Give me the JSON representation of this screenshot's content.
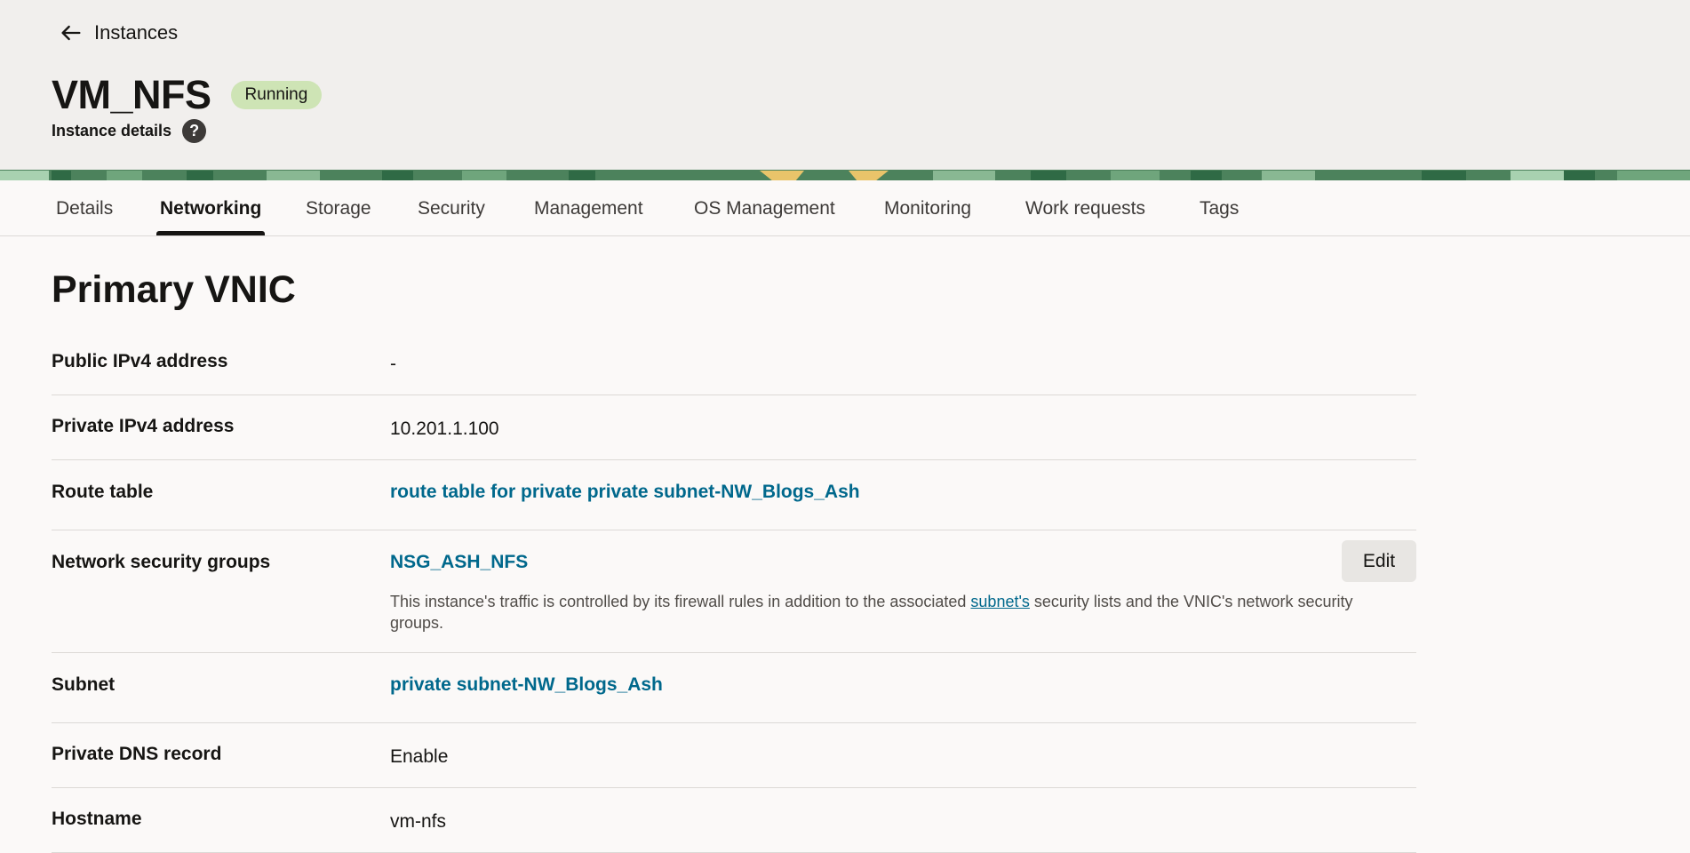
{
  "breadcrumb": {
    "back_label": "Instances"
  },
  "header": {
    "title": "VM_NFS",
    "status": "Running",
    "subtitle": "Instance details",
    "help_icon": "?"
  },
  "tabs": [
    {
      "label": "Details",
      "active": false
    },
    {
      "label": "Networking",
      "active": true
    },
    {
      "label": "Storage",
      "active": false
    },
    {
      "label": "Security",
      "active": false
    },
    {
      "label": "Management",
      "active": false
    },
    {
      "label": "OS Management",
      "active": false
    },
    {
      "label": "Monitoring",
      "active": false
    },
    {
      "label": "Work requests",
      "active": false
    },
    {
      "label": "Tags",
      "active": false
    }
  ],
  "vnic": {
    "title": "Primary VNIC",
    "public_ipv4": {
      "label": "Public IPv4 address",
      "value": "-"
    },
    "private_ipv4": {
      "label": "Private IPv4 address",
      "value": "10.201.1.100"
    },
    "route_table": {
      "label": "Route table",
      "value": "route table for private private subnet-NW_Blogs_Ash"
    },
    "nsg": {
      "label": "Network security groups",
      "value": "NSG_ASH_NFS",
      "edit_label": "Edit",
      "desc_before": "This instance's traffic is controlled by its firewall rules in addition to the associated ",
      "desc_link": "subnet's",
      "desc_after": " security lists and the VNIC's network security groups."
    },
    "subnet": {
      "label": "Subnet",
      "value": "private subnet-NW_Blogs_Ash"
    },
    "private_dns": {
      "label": "Private DNS record",
      "value": "Enable"
    },
    "hostname": {
      "label": "Hostname",
      "value": "vm-nfs"
    }
  },
  "colors": {
    "link": "#00688c",
    "status_badge": "#cee4b5",
    "banner": "#4c825c"
  },
  "icons": {
    "back": "arrow-left-icon",
    "help": "help-icon"
  }
}
